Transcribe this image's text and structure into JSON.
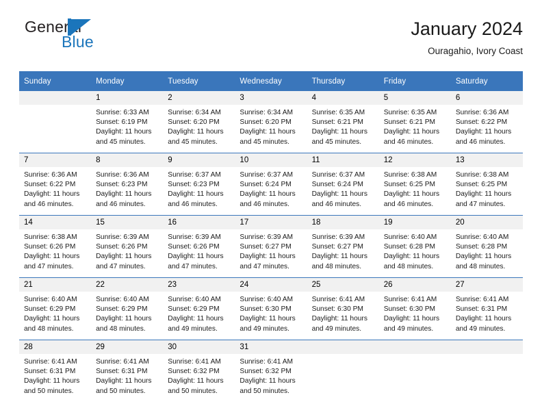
{
  "brand": {
    "name_top": "General",
    "name_bottom": "Blue",
    "color_blue": "#1b75bb",
    "color_dark": "#231f20",
    "mark_icon": "flag-triangle-icon"
  },
  "header": {
    "title": "January 2024",
    "subtitle": "Ouragahio, Ivory Coast"
  },
  "theme": {
    "header_blue": "#3a76bb",
    "daynum_gray": "#f1f1f1",
    "text_dark": "#1a1a1a"
  },
  "calendar": {
    "weekday_headers": [
      "Sunday",
      "Monday",
      "Tuesday",
      "Wednesday",
      "Thursday",
      "Friday",
      "Saturday"
    ],
    "weeks": [
      [
        {
          "day": "",
          "lines": []
        },
        {
          "day": "1",
          "lines": [
            "Sunrise: 6:33 AM",
            "Sunset: 6:19 PM",
            "Daylight: 11 hours",
            "and 45 minutes."
          ]
        },
        {
          "day": "2",
          "lines": [
            "Sunrise: 6:34 AM",
            "Sunset: 6:20 PM",
            "Daylight: 11 hours",
            "and 45 minutes."
          ]
        },
        {
          "day": "3",
          "lines": [
            "Sunrise: 6:34 AM",
            "Sunset: 6:20 PM",
            "Daylight: 11 hours",
            "and 45 minutes."
          ]
        },
        {
          "day": "4",
          "lines": [
            "Sunrise: 6:35 AM",
            "Sunset: 6:21 PM",
            "Daylight: 11 hours",
            "and 45 minutes."
          ]
        },
        {
          "day": "5",
          "lines": [
            "Sunrise: 6:35 AM",
            "Sunset: 6:21 PM",
            "Daylight: 11 hours",
            "and 46 minutes."
          ]
        },
        {
          "day": "6",
          "lines": [
            "Sunrise: 6:36 AM",
            "Sunset: 6:22 PM",
            "Daylight: 11 hours",
            "and 46 minutes."
          ]
        }
      ],
      [
        {
          "day": "7",
          "lines": [
            "Sunrise: 6:36 AM",
            "Sunset: 6:22 PM",
            "Daylight: 11 hours",
            "and 46 minutes."
          ]
        },
        {
          "day": "8",
          "lines": [
            "Sunrise: 6:36 AM",
            "Sunset: 6:23 PM",
            "Daylight: 11 hours",
            "and 46 minutes."
          ]
        },
        {
          "day": "9",
          "lines": [
            "Sunrise: 6:37 AM",
            "Sunset: 6:23 PM",
            "Daylight: 11 hours",
            "and 46 minutes."
          ]
        },
        {
          "day": "10",
          "lines": [
            "Sunrise: 6:37 AM",
            "Sunset: 6:24 PM",
            "Daylight: 11 hours",
            "and 46 minutes."
          ]
        },
        {
          "day": "11",
          "lines": [
            "Sunrise: 6:37 AM",
            "Sunset: 6:24 PM",
            "Daylight: 11 hours",
            "and 46 minutes."
          ]
        },
        {
          "day": "12",
          "lines": [
            "Sunrise: 6:38 AM",
            "Sunset: 6:25 PM",
            "Daylight: 11 hours",
            "and 46 minutes."
          ]
        },
        {
          "day": "13",
          "lines": [
            "Sunrise: 6:38 AM",
            "Sunset: 6:25 PM",
            "Daylight: 11 hours",
            "and 47 minutes."
          ]
        }
      ],
      [
        {
          "day": "14",
          "lines": [
            "Sunrise: 6:38 AM",
            "Sunset: 6:26 PM",
            "Daylight: 11 hours",
            "and 47 minutes."
          ]
        },
        {
          "day": "15",
          "lines": [
            "Sunrise: 6:39 AM",
            "Sunset: 6:26 PM",
            "Daylight: 11 hours",
            "and 47 minutes."
          ]
        },
        {
          "day": "16",
          "lines": [
            "Sunrise: 6:39 AM",
            "Sunset: 6:26 PM",
            "Daylight: 11 hours",
            "and 47 minutes."
          ]
        },
        {
          "day": "17",
          "lines": [
            "Sunrise: 6:39 AM",
            "Sunset: 6:27 PM",
            "Daylight: 11 hours",
            "and 47 minutes."
          ]
        },
        {
          "day": "18",
          "lines": [
            "Sunrise: 6:39 AM",
            "Sunset: 6:27 PM",
            "Daylight: 11 hours",
            "and 48 minutes."
          ]
        },
        {
          "day": "19",
          "lines": [
            "Sunrise: 6:40 AM",
            "Sunset: 6:28 PM",
            "Daylight: 11 hours",
            "and 48 minutes."
          ]
        },
        {
          "day": "20",
          "lines": [
            "Sunrise: 6:40 AM",
            "Sunset: 6:28 PM",
            "Daylight: 11 hours",
            "and 48 minutes."
          ]
        }
      ],
      [
        {
          "day": "21",
          "lines": [
            "Sunrise: 6:40 AM",
            "Sunset: 6:29 PM",
            "Daylight: 11 hours",
            "and 48 minutes."
          ]
        },
        {
          "day": "22",
          "lines": [
            "Sunrise: 6:40 AM",
            "Sunset: 6:29 PM",
            "Daylight: 11 hours",
            "and 48 minutes."
          ]
        },
        {
          "day": "23",
          "lines": [
            "Sunrise: 6:40 AM",
            "Sunset: 6:29 PM",
            "Daylight: 11 hours",
            "and 49 minutes."
          ]
        },
        {
          "day": "24",
          "lines": [
            "Sunrise: 6:40 AM",
            "Sunset: 6:30 PM",
            "Daylight: 11 hours",
            "and 49 minutes."
          ]
        },
        {
          "day": "25",
          "lines": [
            "Sunrise: 6:41 AM",
            "Sunset: 6:30 PM",
            "Daylight: 11 hours",
            "and 49 minutes."
          ]
        },
        {
          "day": "26",
          "lines": [
            "Sunrise: 6:41 AM",
            "Sunset: 6:30 PM",
            "Daylight: 11 hours",
            "and 49 minutes."
          ]
        },
        {
          "day": "27",
          "lines": [
            "Sunrise: 6:41 AM",
            "Sunset: 6:31 PM",
            "Daylight: 11 hours",
            "and 49 minutes."
          ]
        }
      ],
      [
        {
          "day": "28",
          "lines": [
            "Sunrise: 6:41 AM",
            "Sunset: 6:31 PM",
            "Daylight: 11 hours",
            "and 50 minutes."
          ]
        },
        {
          "day": "29",
          "lines": [
            "Sunrise: 6:41 AM",
            "Sunset: 6:31 PM",
            "Daylight: 11 hours",
            "and 50 minutes."
          ]
        },
        {
          "day": "30",
          "lines": [
            "Sunrise: 6:41 AM",
            "Sunset: 6:32 PM",
            "Daylight: 11 hours",
            "and 50 minutes."
          ]
        },
        {
          "day": "31",
          "lines": [
            "Sunrise: 6:41 AM",
            "Sunset: 6:32 PM",
            "Daylight: 11 hours",
            "and 50 minutes."
          ]
        },
        {
          "day": "",
          "lines": []
        },
        {
          "day": "",
          "lines": []
        },
        {
          "day": "",
          "lines": []
        }
      ]
    ]
  }
}
